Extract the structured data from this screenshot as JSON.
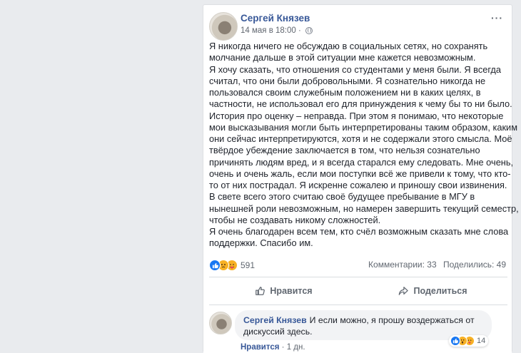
{
  "post": {
    "author": "Сергей Князев",
    "timestamp": "14 мая в 18:00 ·",
    "more_label": "···",
    "lines": [
      "Я никогда ничего не обсуждаю в социальных сетях, но сохранять",
      "молчание дальше в этой ситуации мне кажется невозможным.",
      "Я хочу сказать, что отношения со студентами у меня были. Я всегда",
      "считал, что они были добровольными. Я сознательно никогда не",
      "пользовался своим служебным положением ни в каких целях, в",
      "частности, не использовал его для принуждения к чему бы то ни было.",
      "История про оценку – неправда. При этом я понимаю, что некоторые",
      "мои высказывания могли быть интерпретированы таким образом, каким",
      "они сейчас интерпретируются, хотя и не содержали этого смысла. Моё",
      "твёрдое убеждение заключается в том, что нельзя сознательно",
      "причинять людям вред, и я всегда старался ему следовать. Мне очень,",
      "очень и очень жаль, если мои поступки всё же привели к тому, что кто-",
      "то от них пострадал. Я искренне сожалею и приношу свои извинения.",
      "В свете всего этого считаю своё будущее пребывание в МГУ в",
      "нынешней роли невозможным, но намерен завершить текущий семестр,",
      "чтобы не создавать никому сложностей.",
      "Я очень благодарен всем тем, кто счёл возможным сказать мне слова",
      "поддержки. Спасибо им."
    ]
  },
  "stats": {
    "reactions_count": "591",
    "comments": "Комментарии: 33",
    "shares": "Поделились: 49"
  },
  "actions": {
    "like": "Нравится",
    "share": "Поделиться"
  },
  "comment": {
    "author": "Сергей Князев",
    "text_line1": "И если можно, я прошу воздержаться от",
    "text_line2": "дискуссий здесь.",
    "reactions_count": "14",
    "like": "Нравится",
    "separator": "·",
    "age": "1 дн."
  },
  "icons": {
    "reactions": [
      "like-icon",
      "sad-icon",
      "care-icon"
    ],
    "comment_reactions": [
      "like-icon",
      "wow-icon",
      "care-icon"
    ],
    "like_color": "#1877f2",
    "emoji_color": "#f7b125",
    "link_color": "#385898"
  }
}
